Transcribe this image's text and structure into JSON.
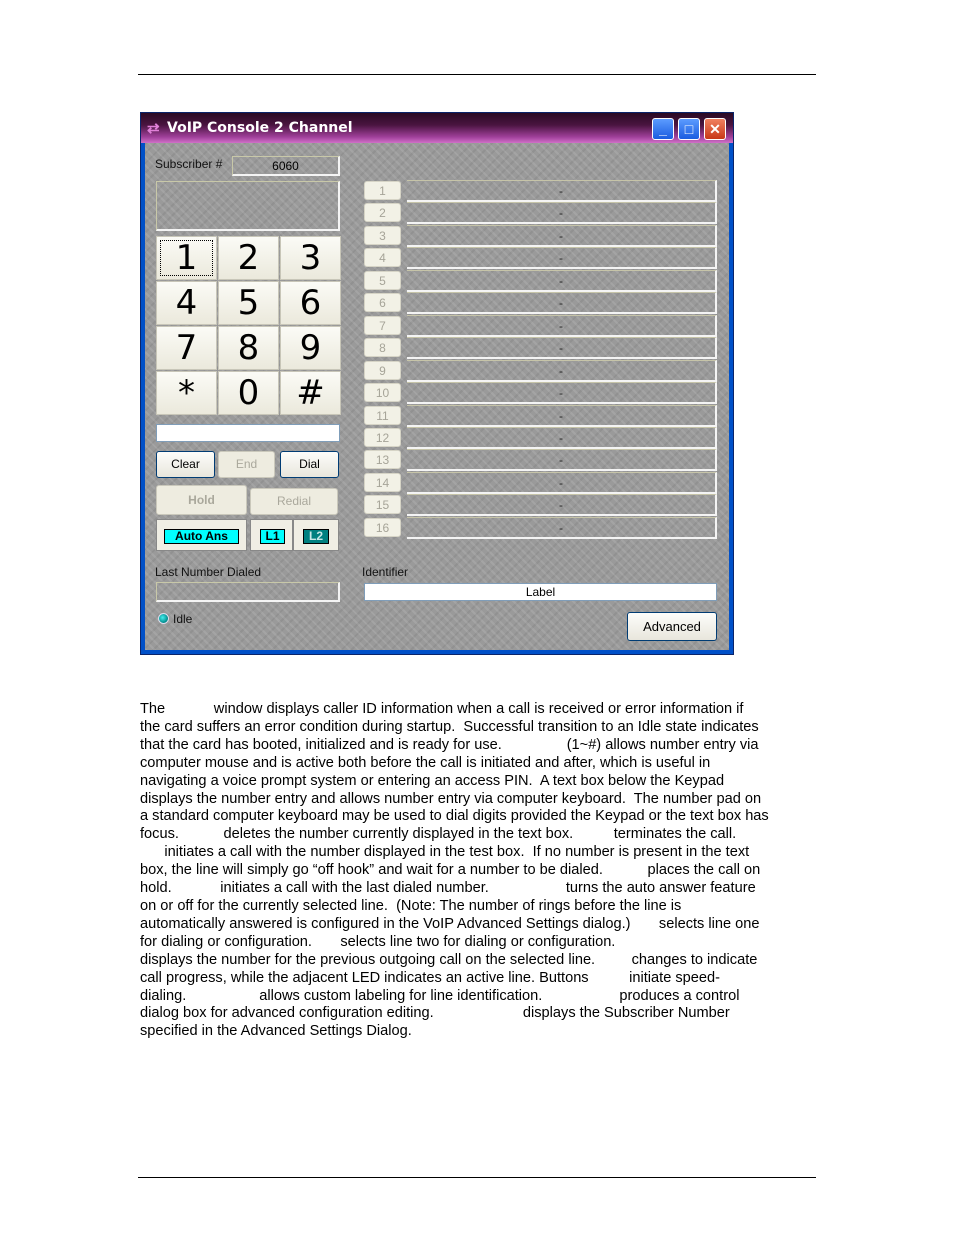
{
  "window": {
    "title": "VoIP Console 2 Channel",
    "controls": {
      "minimize": "_",
      "maximize": "□",
      "close": "✕"
    },
    "subscriber_label": "Subscriber #",
    "subscriber_value": "6060",
    "caller_id_text": "",
    "keypad": [
      "1",
      "2",
      "3",
      "4",
      "5",
      "6",
      "7",
      "8",
      "9",
      "*",
      "0",
      "#"
    ],
    "number_entry_value": "",
    "buttons": {
      "clear": "Clear",
      "end": "End",
      "dial": "Dial",
      "hold": "Hold",
      "redial": "Redial",
      "auto_ans": "Auto Ans",
      "l1": "L1",
      "l2": "L2",
      "advanced": "Advanced"
    },
    "toggle_colors": {
      "auto_ans": "#00ffff",
      "l1": "#00ffff",
      "l2": "#008080"
    },
    "last_number_label": "Last Number Dialed",
    "last_number_value": "",
    "status": "Idle",
    "identifier_label": "Identifier",
    "identifier_value": "Label",
    "speed_dial": [
      {
        "num": "1",
        "value": "-"
      },
      {
        "num": "2",
        "value": "-"
      },
      {
        "num": "3",
        "value": "-"
      },
      {
        "num": "4",
        "value": "-"
      },
      {
        "num": "5",
        "value": "-"
      },
      {
        "num": "6",
        "value": "-"
      },
      {
        "num": "7",
        "value": "-"
      },
      {
        "num": "8",
        "value": "-"
      },
      {
        "num": "9",
        "value": "-"
      },
      {
        "num": "10",
        "value": "-"
      },
      {
        "num": "11",
        "value": "-"
      },
      {
        "num": "12",
        "value": "-"
      },
      {
        "num": "13",
        "value": "-"
      },
      {
        "num": "14",
        "value": "-"
      },
      {
        "num": "15",
        "value": "-"
      },
      {
        "num": "16",
        "value": "-"
      }
    ]
  },
  "paragraph_lines": [
    "The            window displays caller ID information when a call is received or error information if",
    "the card suffers an error condition during startup.  Successful transition to an Idle state indicates",
    "that the card has booted, initialized and is ready for use.                (1~#) allows number entry via",
    "computer mouse and is active both before the call is initiated and after, which is useful in",
    "navigating a voice prompt system or entering an access PIN.  A text box below the Keypad",
    "displays the number entry and allows number entry via computer keyboard.  The number pad on",
    "a standard computer keyboard may be used to dial digits provided the Keypad or the text box has",
    "focus.           deletes the number currently displayed in the text box.          terminates the call.",
    "      initiates a call with the number displayed in the test box.  If no number is present in the text",
    "box, the line will simply go “off hook” and wait for a number to be dialed.           places the call on",
    "hold.            initiates a call with the last dialed number.                   turns the auto answer feature",
    "on or off for the currently selected line.  (Note: The number of rings before the line is",
    "automatically answered is configured in the VoIP Advanced Settings dialog.)       selects line one",
    "for dialing or configuration.       selects line two for dialing or configuration.",
    "displays the number for the previous outgoing call on the selected line.         changes to indicate",
    "call progress, while the adjacent LED indicates an active line. Buttons          initiate speed-",
    "dialing.                  allows custom labeling for line identification.                   produces a control",
    "dialog box for advanced configuration editing.                      displays the Subscriber Number",
    "specified in the Advanced Settings Dialog."
  ]
}
